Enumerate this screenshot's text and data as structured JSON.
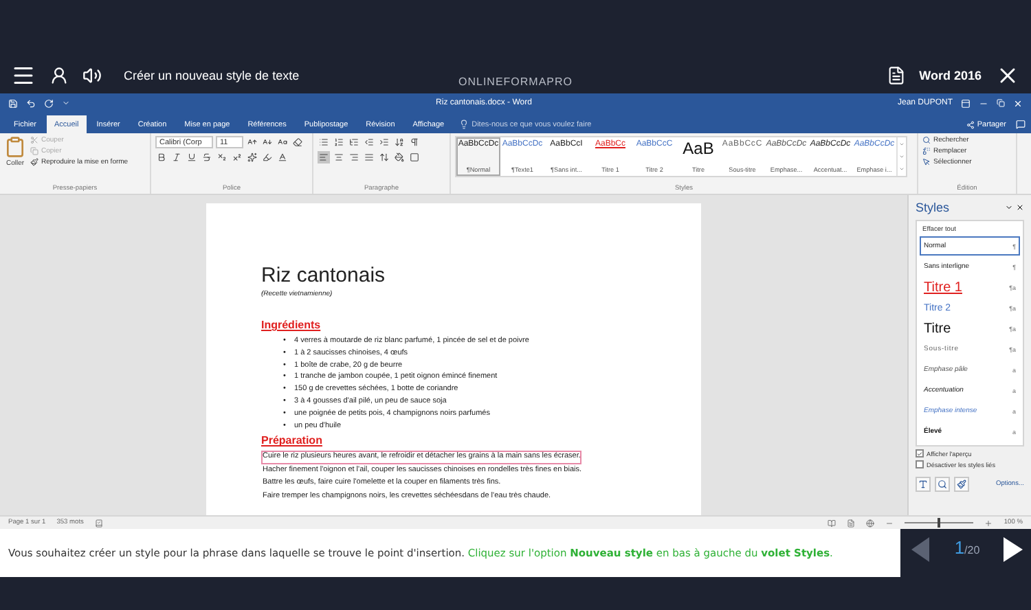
{
  "header": {
    "title": "Créer un nouveau style de texte",
    "brand": "ONLINEFORMAPRO",
    "product": "Word 2016"
  },
  "word": {
    "doc_title": "Riz cantonais.docx - Word",
    "user": "Jean DUPONT",
    "tell_me": "Dites-nous ce que vous voulez faire",
    "share": "Partager",
    "tabs": [
      {
        "label": "Fichier",
        "selected": false
      },
      {
        "label": "Accueil",
        "selected": true
      },
      {
        "label": "Insérer",
        "selected": false
      },
      {
        "label": "Création",
        "selected": false
      },
      {
        "label": "Mise en page",
        "selected": false
      },
      {
        "label": "Références",
        "selected": false
      },
      {
        "label": "Publipostage",
        "selected": false
      },
      {
        "label": "Révision",
        "selected": false
      },
      {
        "label": "Affichage",
        "selected": false
      }
    ]
  },
  "ribbon": {
    "clipboard": {
      "label": "Presse-papiers",
      "paste": "Coller",
      "items": [
        {
          "label": "Couper",
          "kind": "cut",
          "disabled": true
        },
        {
          "label": "Copier",
          "kind": "copy",
          "disabled": true
        },
        {
          "label": "Reproduire la mise en forme",
          "kind": "format",
          "disabled": false
        }
      ]
    },
    "font": {
      "label": "Police",
      "name": "Calibri (Corp",
      "size": "11"
    },
    "paragraph": {
      "label": "Paragraphe"
    },
    "styles": {
      "label": "Styles",
      "items": [
        {
          "preview": "AaBbCcDc",
          "name": "¶Normal",
          "kind": "normal",
          "selected": true
        },
        {
          "preview": "AaBbCcDc",
          "name": "¶Texte1",
          "kind": "body",
          "selected": false
        },
        {
          "preview": "AaBbCcI",
          "name": "¶Sans int...",
          "kind": "nospacing",
          "selected": false
        },
        {
          "preview": "AaBbCc",
          "name": "Titre 1",
          "kind": "heading1",
          "selected": false
        },
        {
          "preview": "AaBbCcC",
          "name": "Titre 2",
          "kind": "heading2",
          "selected": false
        },
        {
          "preview": "AaB",
          "name": "Titre",
          "kind": "title",
          "selected": false
        },
        {
          "preview": "AaBbCcC",
          "name": "Sous-titre",
          "kind": "subtitle",
          "selected": false
        },
        {
          "preview": "AaBbCcDc",
          "name": "Emphase...",
          "kind": "subtle",
          "selected": false
        },
        {
          "preview": "AaBbCcDc",
          "name": "Accentuat...",
          "kind": "emphasis",
          "selected": false
        },
        {
          "preview": "AaBbCcDc",
          "name": "Emphase i...",
          "kind": "intense",
          "selected": false
        }
      ]
    },
    "editing": {
      "label": "Édition",
      "items": [
        {
          "label": "Rechercher",
          "kind": "find"
        },
        {
          "label": "Remplacer",
          "kind": "replace"
        },
        {
          "label": "Sélectionner",
          "kind": "select"
        }
      ]
    }
  },
  "document": {
    "title": "Riz cantonais",
    "subtitle": "(Recette vietnamienne)",
    "sections": [
      {
        "heading": "Ingrédients",
        "kind": "bullets",
        "marker": "•",
        "items": [
          {
            "text": "4 verres à moutarde de riz blanc parfumé, 1 pincée de sel et de poivre",
            "selected": false
          },
          {
            "text": "1 à 2 saucisses chinoises, 4 œufs",
            "selected": false
          },
          {
            "text": "1 boîte de crabe, 20 g de beurre",
            "selected": false
          },
          {
            "text": "1 tranche de jambon coupée, 1 petit oignon émincé finement",
            "selected": false
          },
          {
            "text": "150 g de crevettes séchées, 1 botte de coriandre",
            "selected": false
          },
          {
            "text": "3 à 4 gousses d'ail pilé, un peu de sauce soja",
            "selected": false
          },
          {
            "text": "une poignée de petits pois, 4 champignons noirs parfumés",
            "selected": false
          },
          {
            "text": "un peu d'huile",
            "selected": false
          }
        ]
      },
      {
        "heading": "Préparation",
        "kind": "paragraphs",
        "items": [
          {
            "text": "Cuire le riz plusieurs heures avant, le refroidir et détacher les grains à la main sans les écraser.",
            "selected": true
          },
          {
            "text": "Hacher finement l'oignon et l'ail, couper les saucisses chinoises en rondelles très fines en biais.",
            "selected": false
          },
          {
            "text": "Battre les œufs, faire cuire l'omelette et la couper en filaments très fins.",
            "selected": false
          },
          {
            "text": "Faire tremper les champignons noirs, les crevettes séchéesdans de l'eau très chaude.",
            "selected": false
          }
        ]
      }
    ]
  },
  "styles_pane": {
    "title": "Styles",
    "clear": "Effacer tout",
    "items": [
      {
        "name": "Normal",
        "mark": "¶",
        "kind": "normal",
        "selected": true
      },
      {
        "name": "Sans interligne",
        "mark": "¶",
        "kind": "nospacing",
        "selected": false
      },
      {
        "name": "Titre 1",
        "mark": "¶a",
        "kind": "heading1",
        "selected": false
      },
      {
        "name": "Titre 2",
        "mark": "¶a",
        "kind": "heading2",
        "selected": false
      },
      {
        "name": "Titre",
        "mark": "¶a",
        "kind": "title",
        "selected": false
      },
      {
        "name": "Sous-titre",
        "mark": "¶a",
        "kind": "subtitle",
        "selected": false
      },
      {
        "name": "Emphase pâle",
        "mark": "a",
        "kind": "subtle",
        "selected": false
      },
      {
        "name": "Accentuation",
        "mark": "a",
        "kind": "emphasis",
        "selected": false
      },
      {
        "name": "Emphase intense",
        "mark": "a",
        "kind": "intense",
        "selected": false
      },
      {
        "name": "Élevé",
        "mark": "a",
        "kind": "strong",
        "selected": false
      }
    ],
    "options": [
      {
        "label": "Afficher l'aperçu",
        "checked": true
      },
      {
        "label": "Désactiver les styles liés",
        "checked": false
      }
    ],
    "options_link": "Options..."
  },
  "status_bar": {
    "page": "Page 1 sur 1",
    "words": "353 mots",
    "zoom": "100 %",
    "level": 0.5
  },
  "instruction": [
    {
      "kind": "plain",
      "text": "Vous souhaitez créer un style pour la phrase dans laquelle se trouve le point d'insertion."
    },
    {
      "kind": "hint",
      "text": "Cliquez sur l'option **Nouveau style** en bas à gauche du **volet Styles**."
    }
  ],
  "pager": {
    "current": "1",
    "total": "/20",
    "prev_disabled": true
  }
}
